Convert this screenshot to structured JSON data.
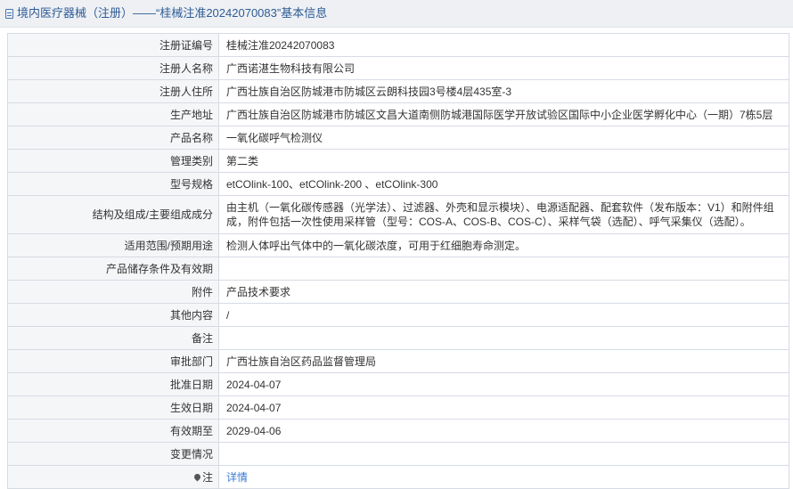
{
  "header": {
    "title": "境内医疗器械（注册）——“桂械注准20242070083”基本信息"
  },
  "rows": [
    {
      "label": "注册证编号",
      "value": "桂械注准20242070083"
    },
    {
      "label": "注册人名称",
      "value": "广西诺湛生物科技有限公司"
    },
    {
      "label": "注册人住所",
      "value": "广西壮族自治区防城港市防城区云朗科技园3号楼4层435室-3"
    },
    {
      "label": "生产地址",
      "value": "广西壮族自治区防城港市防城区文昌大道南侧防城港国际医学开放试验区国际中小企业医学孵化中心（一期）7栋5层"
    },
    {
      "label": "产品名称",
      "value": "一氧化碳呼气检测仪"
    },
    {
      "label": "管理类别",
      "value": "第二类"
    },
    {
      "label": "型号规格",
      "value": "etCOlink-100、etCOlink-200 、etCOlink-300"
    },
    {
      "label": "结构及组成/主要组成成分",
      "value": "由主机（一氧化碳传感器（光学法）、过滤器、外壳和显示模块）、电源适配器、配套软件（发布版本：V1）和附件组成，附件包括一次性使用采样管（型号：COS-A、COS-B、COS-C）、采样气袋（选配）、呼气采集仪（选配）。"
    },
    {
      "label": "适用范围/预期用途",
      "value": "检测人体呼出气体中的一氧化碳浓度，可用于红细胞寿命测定。"
    },
    {
      "label": "产品储存条件及有效期",
      "value": ""
    },
    {
      "label": "附件",
      "value": "产品技术要求"
    },
    {
      "label": "其他内容",
      "value": "/"
    },
    {
      "label": "备注",
      "value": ""
    },
    {
      "label": "审批部门",
      "value": "广西壮族自治区药品监督管理局"
    },
    {
      "label": "批准日期",
      "value": "2024-04-07"
    },
    {
      "label": "生效日期",
      "value": "2024-04-07"
    },
    {
      "label": "有效期至",
      "value": "2029-04-06"
    },
    {
      "label": "变更情况",
      "value": ""
    }
  ],
  "note": {
    "label": "注",
    "link_text": "详情",
    "icon": "map-pin-icon"
  },
  "colors": {
    "title_text": "#2d5b95",
    "title_bg": "#eef0f4",
    "label_bg": "#f5f6f8",
    "border": "#d6dbe3",
    "link": "#3a7bd5"
  }
}
